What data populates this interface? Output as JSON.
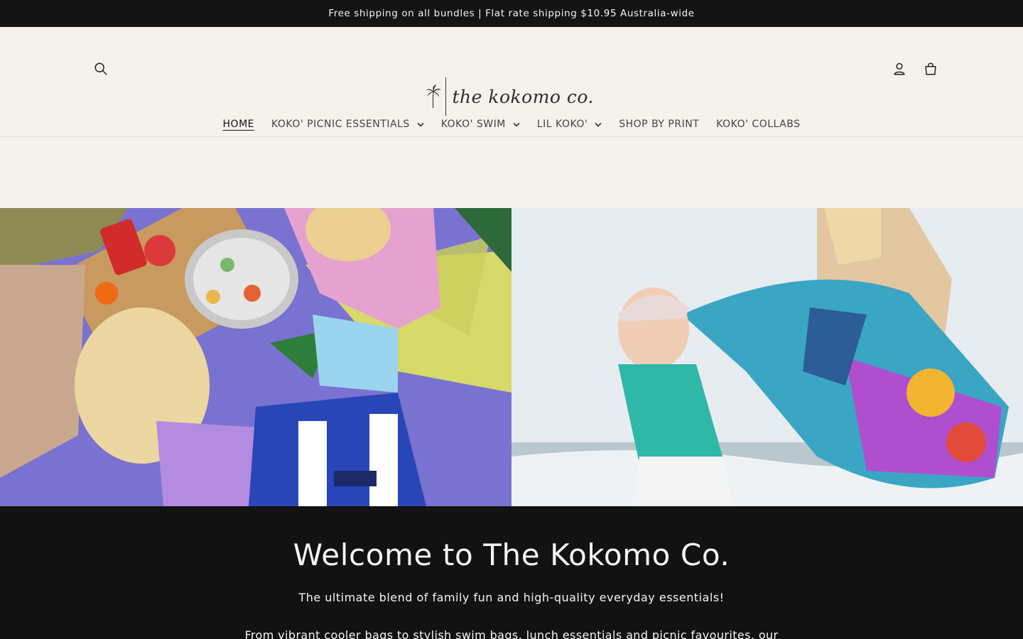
{
  "announcement": {
    "text": "Free shipping on all bundles | Flat rate shipping $10.95 Australia-wide"
  },
  "header": {
    "logo_text": "the kokomo co.",
    "icons": {
      "search": "search-icon",
      "account": "account-icon",
      "cart": "cart-icon"
    }
  },
  "nav": {
    "items": [
      {
        "label": "HOME",
        "active": true,
        "dropdown": false
      },
      {
        "label": "KOKO' PICNIC ESSENTIALS",
        "dropdown": true
      },
      {
        "label": "KOKO' SWIM",
        "dropdown": true
      },
      {
        "label": "LIL KOKO'",
        "dropdown": true
      },
      {
        "label": "SHOP BY PRINT",
        "dropdown": false
      },
      {
        "label": "KOKO' COLLABS",
        "dropdown": false
      }
    ]
  },
  "welcome": {
    "title": "Welcome to The Kokomo Co.",
    "tagline": "The ultimate blend of family fun and high-quality everyday essentials!",
    "body": "From vibrant cooler bags to stylish swim bags, lunch essentials and picnic favourites, our"
  },
  "colors": {
    "dark": "#141414",
    "cream": "#f5f1eb",
    "text": "#1a1a1a"
  }
}
